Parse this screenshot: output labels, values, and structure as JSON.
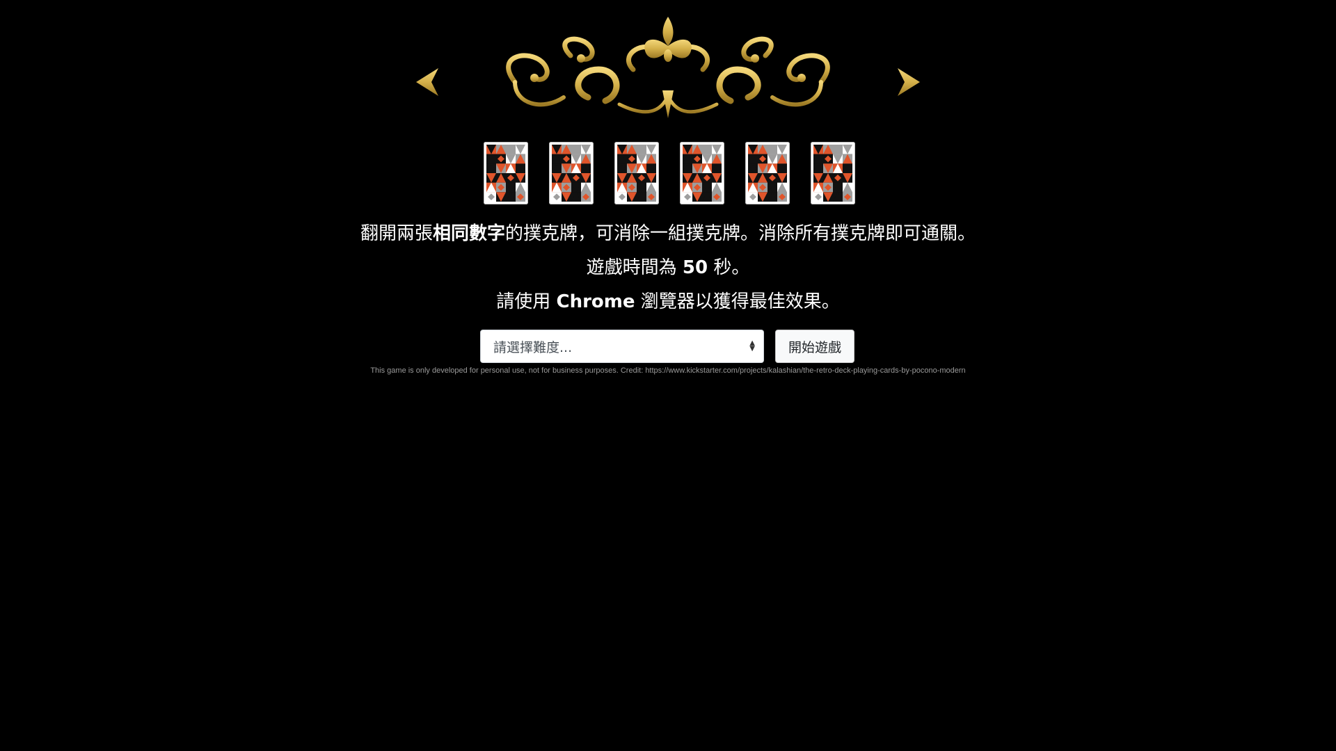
{
  "header": {
    "ornament_icon": "gold-filigree-ornament-icon",
    "ornament_color": "#D4B04A"
  },
  "cards": [
    {
      "face": "card-back-icon"
    },
    {
      "face": "card-back-icon"
    },
    {
      "face": "card-back-icon"
    },
    {
      "face": "card-back-icon"
    },
    {
      "face": "card-back-icon"
    },
    {
      "face": "card-back-icon"
    }
  ],
  "card_colors": {
    "orange": "#E0552B",
    "black": "#111111",
    "grey": "#9E9E9E",
    "white": "#FFFFFF"
  },
  "instructions": {
    "line1_before": "翻開兩張",
    "line1_bold": "相同數字",
    "line1_after": "的撲克牌，可消除一組撲克牌。消除所有撲克牌即可通關。",
    "line2_before": "遊戲時間為 ",
    "line2_bold": "50",
    "line2_after": " 秒。",
    "line3_before": "請使用 ",
    "line3_bold": "Chrome",
    "line3_after": " 瀏覽器以獲得最佳效果。"
  },
  "controls": {
    "difficulty_placeholder": "請選擇難度...",
    "start_label": "開始遊戲"
  },
  "footer": {
    "credit": "This game is only developed for personal use, not for business purposes. Credit: https://www.kickstarter.com/projects/kalashian/the-retro-deck-playing-cards-by-pocono-modern"
  }
}
